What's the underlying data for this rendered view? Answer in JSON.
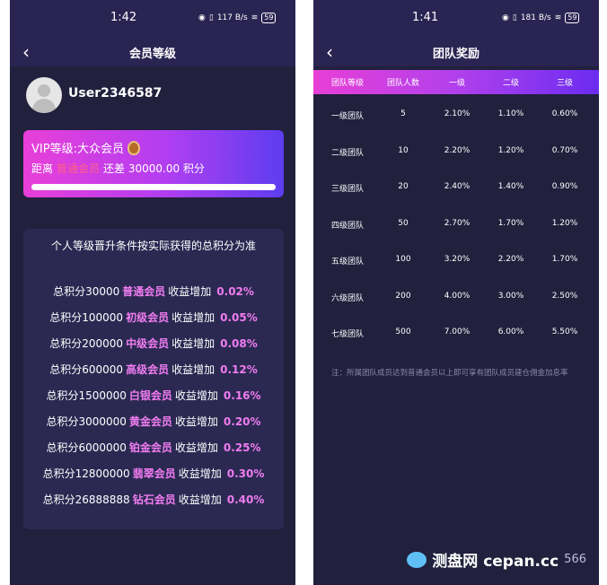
{
  "left_screen": {
    "status_time": "1:42",
    "status_net": "117 B/s",
    "battery": "59",
    "nav_title": "会员等级",
    "username": "User2346587",
    "vip_card": {
      "level_text": "VIP等级:大众会员",
      "distance_prefix": "距离",
      "next_level": "普通会员",
      "distance_suffix": "还差 30000.00 积分",
      "progress_fraction": 1.0
    },
    "conditions": {
      "title": "个人等级晋升条件按实际获得的总积分为准",
      "rows": [
        {
          "points": "总积分30000",
          "level": "普通会员",
          "gain": "收益增加",
          "rate": "0.02%"
        },
        {
          "points": "总积分100000",
          "level": "初级会员",
          "gain": "收益增加",
          "rate": "0.05%"
        },
        {
          "points": "总积分200000",
          "level": "中级会员",
          "gain": "收益增加",
          "rate": "0.08%"
        },
        {
          "points": "总积分600000",
          "level": "高级会员",
          "gain": "收益增加",
          "rate": "0.12%"
        },
        {
          "points": "总积分1500000",
          "level": "白银会员",
          "gain": "收益增加",
          "rate": "0.16%"
        },
        {
          "points": "总积分3000000",
          "level": "黄金会员",
          "gain": "收益增加",
          "rate": "0.20%"
        },
        {
          "points": "总积分6000000",
          "level": "铂金会员",
          "gain": "收益增加",
          "rate": "0.25%"
        },
        {
          "points": "总积分12800000",
          "level": "翡翠会员",
          "gain": "收益增加",
          "rate": "0.30%"
        },
        {
          "points": "总积分26888888",
          "level": "钻石会员",
          "gain": "收益增加",
          "rate": "0.40%"
        }
      ]
    }
  },
  "right_screen": {
    "status_time": "1:41",
    "status_net": "181 B/s",
    "battery": "59",
    "nav_title": "团队奖励",
    "columns": [
      "团队等级",
      "团队人数",
      "一级",
      "二级",
      "三级"
    ],
    "rows": [
      [
        "一级团队",
        "5",
        "2.10%",
        "1.10%",
        "0.60%"
      ],
      [
        "二级团队",
        "10",
        "2.20%",
        "1.20%",
        "0.70%"
      ],
      [
        "三级团队",
        "20",
        "2.40%",
        "1.40%",
        "0.90%"
      ],
      [
        "四级团队",
        "50",
        "2.70%",
        "1.70%",
        "1.20%"
      ],
      [
        "五级团队",
        "100",
        "3.20%",
        "2.20%",
        "1.70%"
      ],
      [
        "六级团队",
        "200",
        "4.00%",
        "3.00%",
        "2.50%"
      ],
      [
        "七级团队",
        "500",
        "7.00%",
        "6.00%",
        "5.50%"
      ]
    ],
    "note": "注：所属团队成员达到普通会员以上即可享有团队成员建仓佣金加息率"
  },
  "watermark": {
    "text": "测盘网 cepan.cc",
    "extra": "566"
  },
  "colors": {
    "bg": "#21203d",
    "accent": "#f07cf0",
    "card_gradient_start": "#e93fd8",
    "card_gradient_end": "#5d3df0"
  }
}
